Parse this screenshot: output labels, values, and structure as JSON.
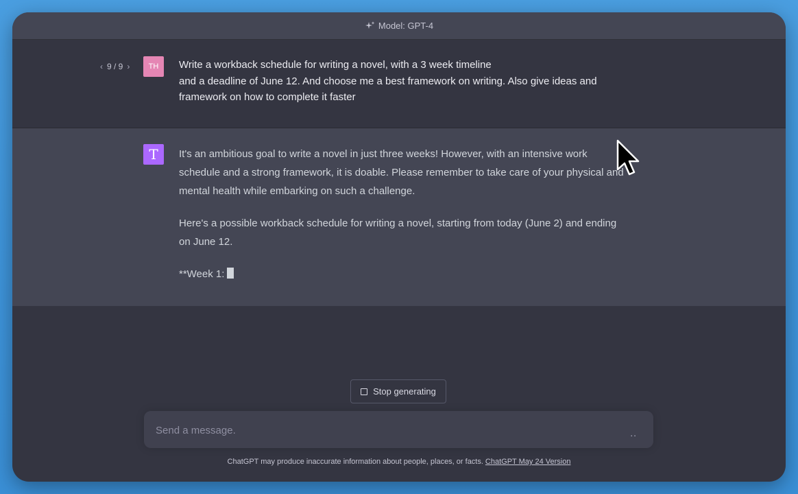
{
  "header": {
    "model_label": "Model: GPT-4"
  },
  "user_message": {
    "pager": "9 / 9",
    "avatar_initials": "TH",
    "lines": [
      "Write a workback schedule for writing a novel, with a 3 week timeline",
      "and a deadline of June 12. And choose me a best framework on writing. Also give ideas and",
      "framework on how to complete it faster"
    ]
  },
  "assistant_message": {
    "avatar_letter": "T",
    "paragraphs": [
      "It's an ambitious goal to write a novel in just three weeks! However, with an intensive work schedule and a strong framework, it is doable. Please remember to take care of your physical and mental health while embarking on such a challenge.",
      "Here's a possible workback schedule for writing a novel, starting from today (June 2) and ending on June 12.",
      "**Week 1:"
    ]
  },
  "stop_button": {
    "label": "Stop generating"
  },
  "composer": {
    "placeholder": "Send a message.",
    "dots": ".."
  },
  "footer": {
    "disclaimer": "ChatGPT may produce inaccurate information about people, places, or facts.",
    "version_link": "ChatGPT May 24 Version"
  },
  "colors": {
    "user_avatar": "#e586b4",
    "bot_avatar": "#ab68ff",
    "background": "#343541",
    "assistant_bg": "#444654"
  }
}
